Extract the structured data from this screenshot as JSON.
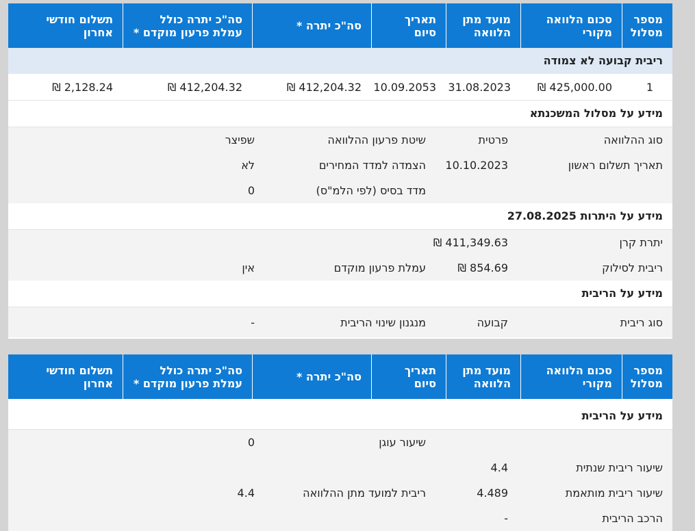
{
  "table_header": {
    "columns": [
      "מספר מסלול",
      "סכום הלוואה מקורי",
      "מועד מתן הלוואה",
      "תאריך סיום",
      "סה\"כ יתרה *",
      "סה\"כ יתרה כולל עמלת פרעון מוקדם *",
      "תשלום חודשי אחרון"
    ]
  },
  "panel1": {
    "group_title": "ריבית קבועה לא צמודה",
    "loan_row": {
      "track_number": "1",
      "original_amount": "₪ 425,000.00",
      "loan_date": "31.08.2023",
      "end_date": "10.09.2053",
      "total_balance": "₪ 412,204.32",
      "total_with_fee": "₪ 412,204.32",
      "last_payment": "₪ 2,128.24"
    },
    "mortgage_info": {
      "title": "מידע על מסלול המשכנתא",
      "rows": [
        {
          "label": "סוג ההלוואה",
          "value": "פרטית",
          "label2": "שיטת פרעון ההלוואה",
          "value2": "שפיצר"
        },
        {
          "label": "תאריך תשלום ראשון",
          "value": "10.10.2023",
          "label2": "הצמדה למדד המחירים",
          "value2": "לא"
        },
        {
          "label": "",
          "value": "",
          "label2": "מדד בסיס (לפי הלמ\"ס)",
          "value2": "0"
        }
      ]
    },
    "balance_info": {
      "title": "מידע על היתרות 27.08.2025",
      "rows": [
        {
          "label": "יתרת קרן",
          "value": "₪ 411,349.63",
          "label2": "",
          "value2": ""
        },
        {
          "label": "ריבית לסילוק",
          "value": "₪ 854.69",
          "label2": "עמלת פרעון מוקדם",
          "value2": "אין"
        }
      ]
    },
    "interest_info": {
      "title": "מידע על הריבית",
      "rows": [
        {
          "label": "סוג ריבית",
          "value": "קבועה",
          "label2": "מנגנון שינוי הריבית",
          "value2": "-"
        }
      ]
    }
  },
  "panel2": {
    "interest_info": {
      "title": "מידע על הריבית",
      "rows": [
        {
          "label": "",
          "value": "",
          "label2": "שיעור עוגן",
          "value2": "0"
        },
        {
          "label": "שיעור ריבית שנתית",
          "value": "4.4",
          "label2": "",
          "value2": ""
        },
        {
          "label": "שיעור ריבית מותאמת",
          "value": "4.489",
          "label2": "ריבית למועד מתן ההלוואה",
          "value2": "4.4"
        },
        {
          "label": "הרכב הריבית",
          "value": "-",
          "label2": "",
          "value2": ""
        }
      ]
    }
  }
}
